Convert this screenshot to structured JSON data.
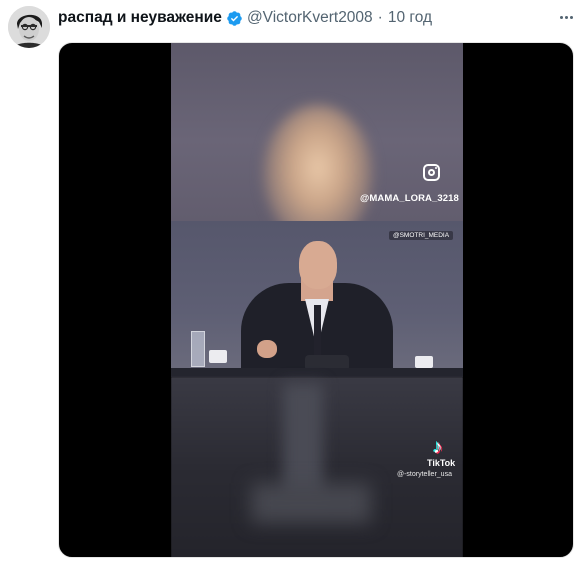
{
  "tweet": {
    "display_name": "распад и неуважение",
    "handle": "@VictorKvert2008",
    "separator": "·",
    "timestamp": "10 год",
    "verified_icon": "verified-badge-icon",
    "more_icon": "more-options-icon"
  },
  "video": {
    "instagram_icon": "instagram-icon",
    "instagram_handle": "@MAMA_LORA_3218",
    "channel_tag": "@SMOTRI_MEDIA",
    "tiktok_icon": "tiktok-icon",
    "tiktok_label": "TikTok",
    "tiktok_user": "@-storyteller_usa"
  },
  "colors": {
    "name": "#0f1419",
    "secondary_text": "#536471",
    "verified": "#1d9bf0",
    "media_background": "#000000"
  }
}
